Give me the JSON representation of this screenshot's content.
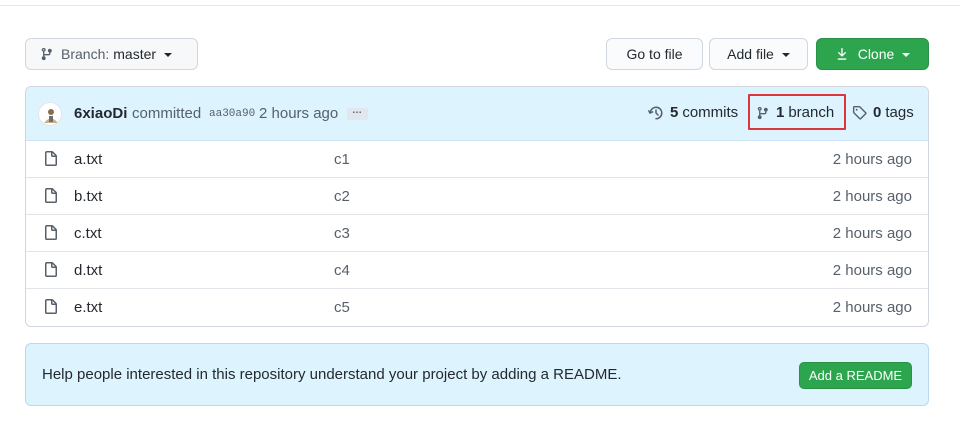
{
  "toolbar": {
    "branch_prefix": "Branch:",
    "branch_name": "master",
    "goto_file": "Go to file",
    "add_file": "Add file",
    "clone": "Clone"
  },
  "commit": {
    "author": "6xiaoDi",
    "verb": "committed",
    "sha": "aa30a90",
    "time": "2 hours ago",
    "ellipsis": "…"
  },
  "stats": {
    "commits_count": "5",
    "commits_label": "commits",
    "branch_count": "1",
    "branch_label": "branch",
    "tags_count": "0",
    "tags_label": "tags"
  },
  "files": [
    {
      "name": "a.txt",
      "message": "c1",
      "time": "2 hours ago"
    },
    {
      "name": "b.txt",
      "message": "c2",
      "time": "2 hours ago"
    },
    {
      "name": "c.txt",
      "message": "c3",
      "time": "2 hours ago"
    },
    {
      "name": "d.txt",
      "message": "c4",
      "time": "2 hours ago"
    },
    {
      "name": "e.txt",
      "message": "c5",
      "time": "2 hours ago"
    }
  ],
  "readme": {
    "text": "Help people interested in this repository understand your project by adding a README.",
    "button": "Add a README"
  },
  "colors": {
    "primary_green": "#2da44e",
    "info_blue": "#ddf4ff",
    "highlight_red": "#d9363e"
  },
  "icons": [
    "git-branch-icon",
    "download-icon",
    "history-icon",
    "tag-icon",
    "file-icon",
    "avatar"
  ]
}
